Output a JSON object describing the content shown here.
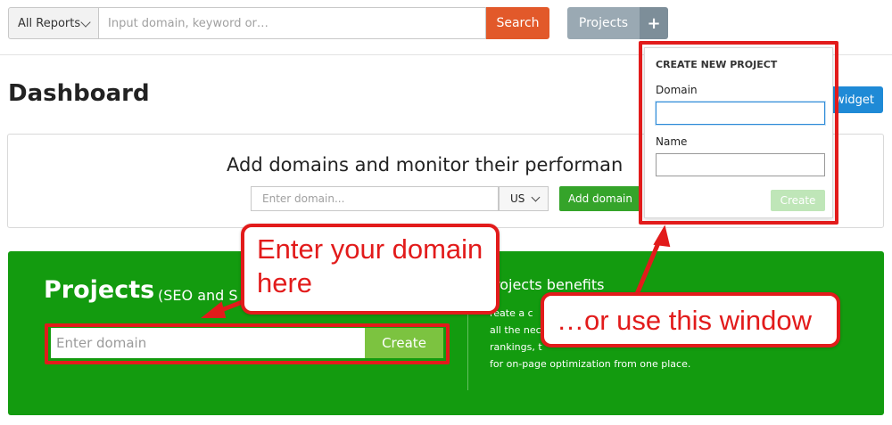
{
  "topbar": {
    "reports_select": "All Reports",
    "search_placeholder": "Input domain, keyword or…",
    "search_button": "Search",
    "projects_button": "Projects",
    "plus_button": "+"
  },
  "dashboard": {
    "title": "Dashboard",
    "widget_button": "widget",
    "domains_heading": "Add domains and monitor their performan",
    "domain_placeholder": "Enter domain...",
    "country": "US",
    "add_domain_button": "Add domain"
  },
  "projects_panel": {
    "title": "Projects",
    "subtitle": "(SEO and S",
    "input_placeholder": "Enter domain",
    "create_button": "Create",
    "benefits_title": "rojects benefits",
    "benefits_lines": [
      "reate a c",
      "all the nec",
      "rankings, t",
      "for on-page optimization from one place."
    ]
  },
  "popover": {
    "title": "CREATE NEW PROJECT",
    "domain_label": "Domain",
    "name_label": "Name",
    "create_button": "Create"
  },
  "annotations": {
    "callout_domain_line1": "Enter your domain",
    "callout_domain_line2": "here",
    "callout_window": "…or use this window"
  },
  "colors": {
    "search_orange": "#e2592a",
    "projects_grey": "#9aa9b3",
    "panel_green": "#139b0f",
    "create_green": "#7cc340",
    "annotation_red": "#e21b1b"
  }
}
